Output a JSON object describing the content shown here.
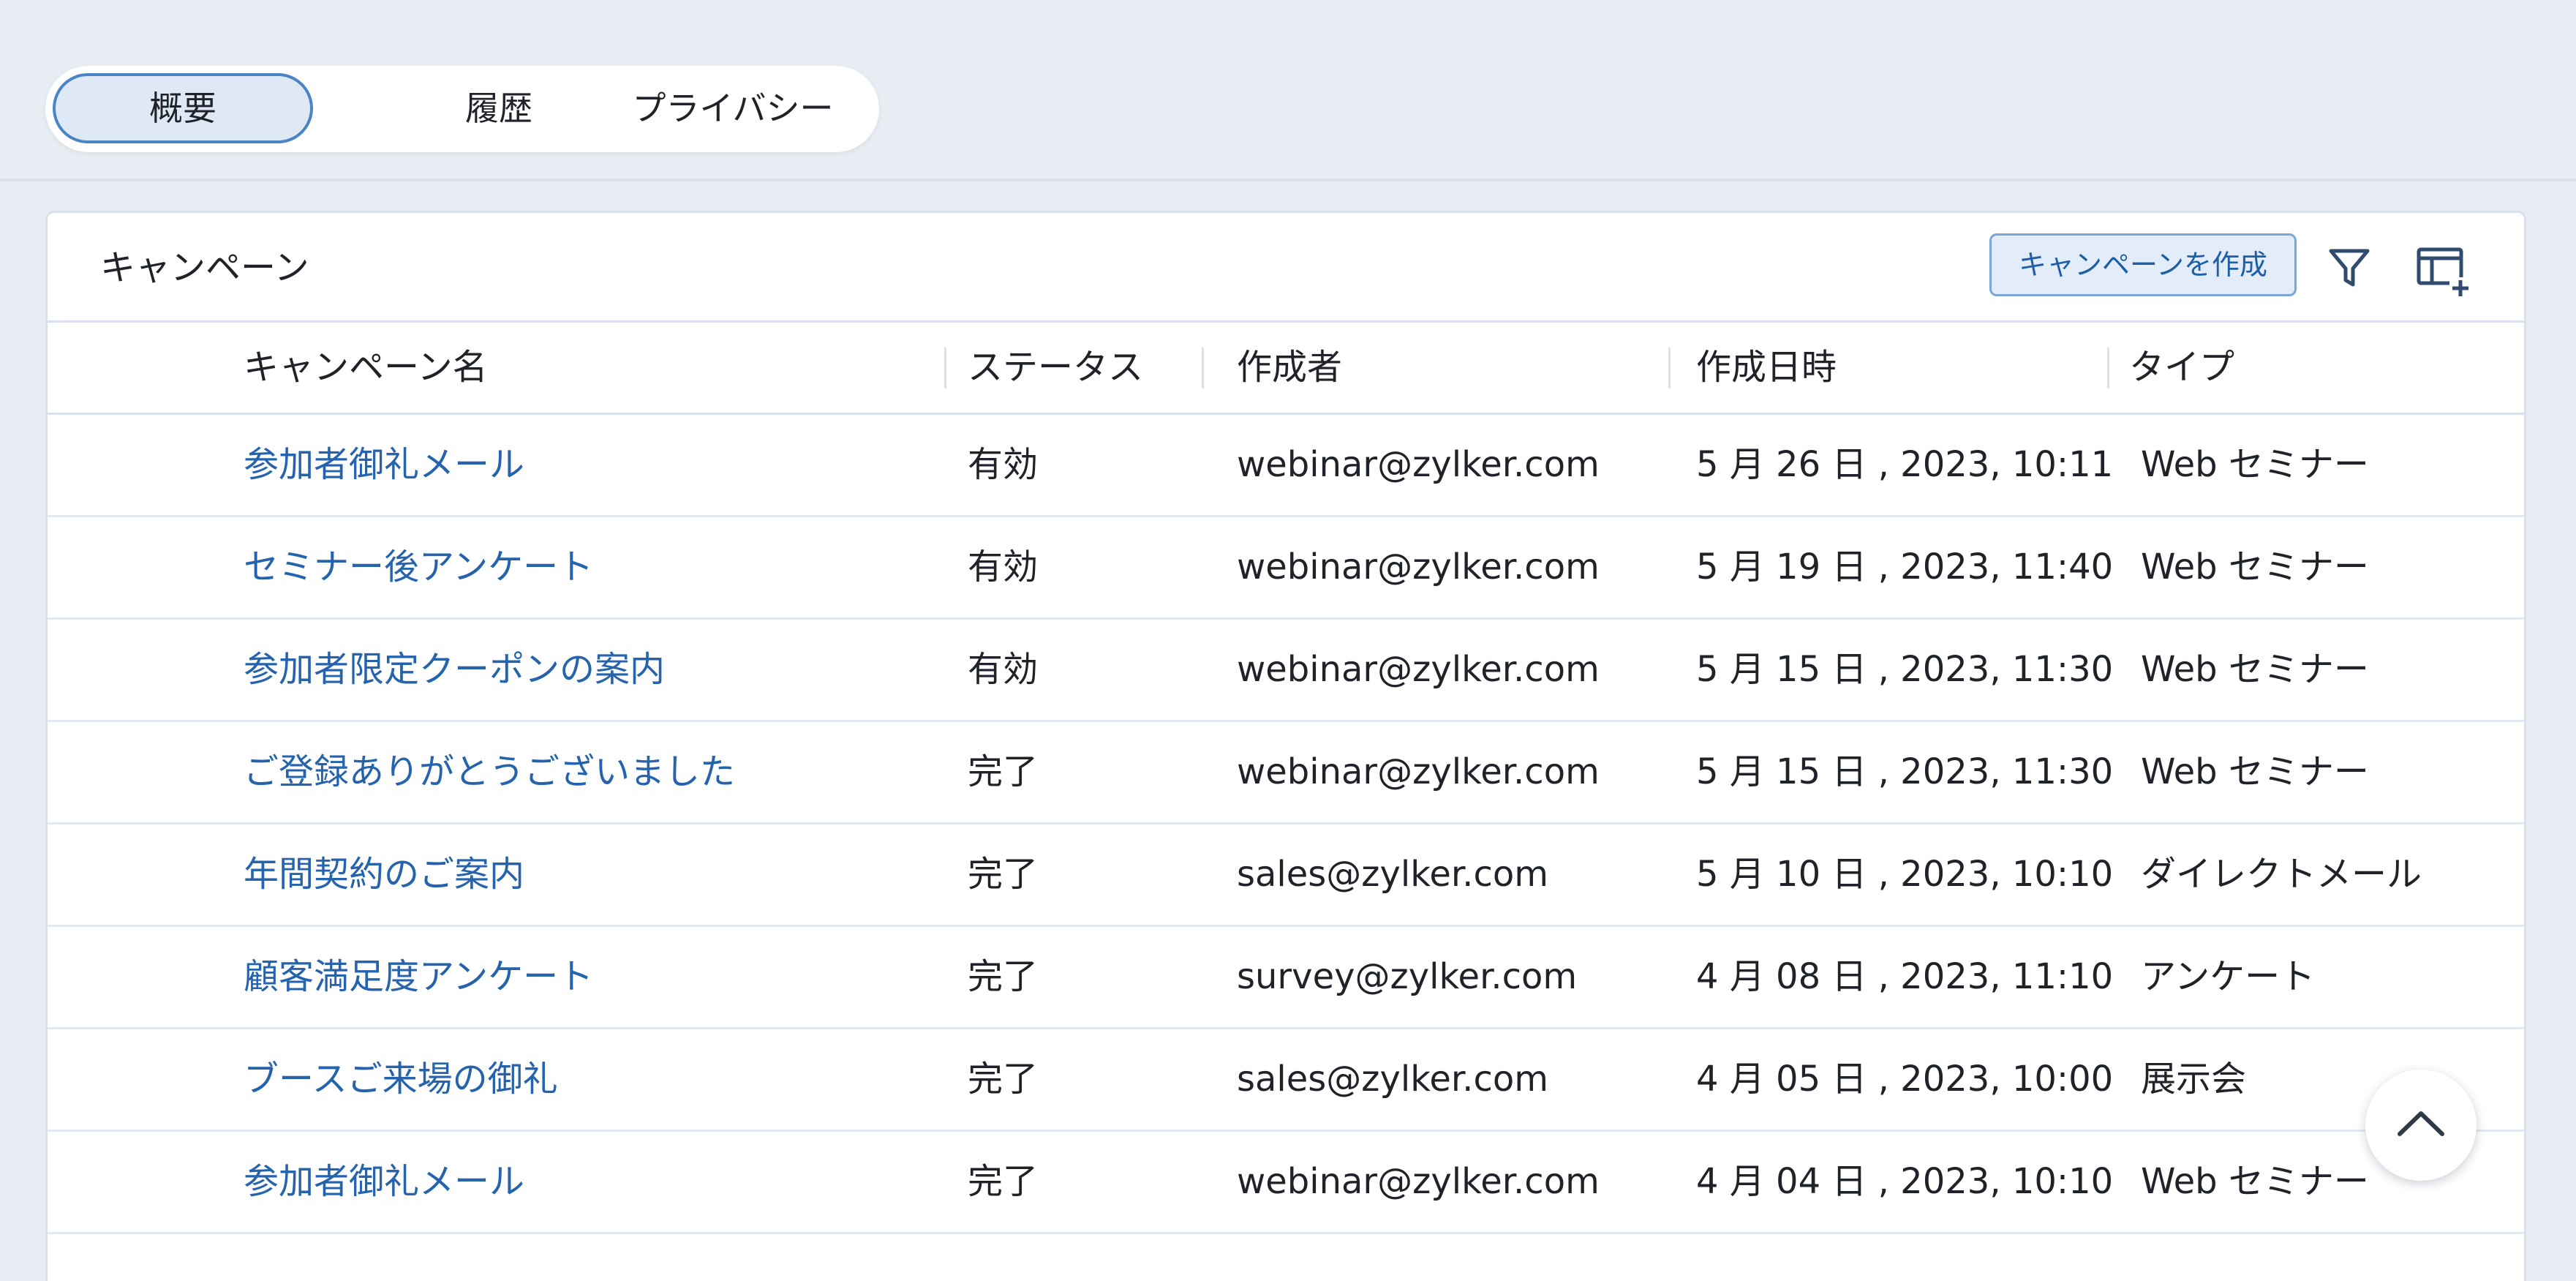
{
  "tabs": [
    {
      "label": "概要",
      "active": true
    },
    {
      "label": "履歴",
      "active": false
    },
    {
      "label": "プライバシー",
      "active": false
    }
  ],
  "campaigns": {
    "title": "キャンペーン",
    "create_button": "キャンペーンを作成",
    "filter_icon": "filter-icon",
    "table_settings_icon": "add-column-icon",
    "columns": [
      "キャンペーン名",
      "ステータス",
      "作成者",
      "作成日時",
      "タイプ"
    ],
    "rows": [
      {
        "name": "参加者御礼メール",
        "status": "有効",
        "owner": "webinar@zylker.com",
        "created": "5 月 26 日 , 2023, 10:11",
        "type": "Web セミナー"
      },
      {
        "name": "セミナー後アンケート",
        "status": "有効",
        "owner": "webinar@zylker.com",
        "created": "5 月 19 日 , 2023, 11:40",
        "type": "Web セミナー"
      },
      {
        "name": "参加者限定クーポンの案内",
        "status": "有効",
        "owner": "webinar@zylker.com",
        "created": "5 月 15 日 , 2023, 11:30",
        "type": "Web セミナー"
      },
      {
        "name": "ご登録ありがとうございました",
        "status": "完了",
        "owner": "webinar@zylker.com",
        "created": "5 月 15 日 , 2023, 11:30",
        "type": "Web セミナー"
      },
      {
        "name": "年間契約のご案内",
        "status": "完了",
        "owner": "sales@zylker.com",
        "created": "5 月 10 日 , 2023, 10:10",
        "type": "ダイレクトメール"
      },
      {
        "name": "顧客満足度アンケート",
        "status": "完了",
        "owner": "survey@zylker.com",
        "created": "4 月 08 日 , 2023, 11:10",
        "type": "アンケート"
      },
      {
        "name": "ブースご来場の御礼",
        "status": "完了",
        "owner": "sales@zylker.com",
        "created": "4 月 05 日 , 2023, 10:00",
        "type": "展示会"
      },
      {
        "name": "参加者御礼メール",
        "status": "完了",
        "owner": "webinar@zylker.com",
        "created": "4 月 04 日 , 2023, 10:10",
        "type": "Web セミナー"
      }
    ]
  },
  "scroll_top_icon": "chevron-up-icon",
  "colors": {
    "background": "#e8edf3",
    "link": "#2563ad",
    "accent": "#4a84c6",
    "button_bg": "#e3edf9"
  }
}
